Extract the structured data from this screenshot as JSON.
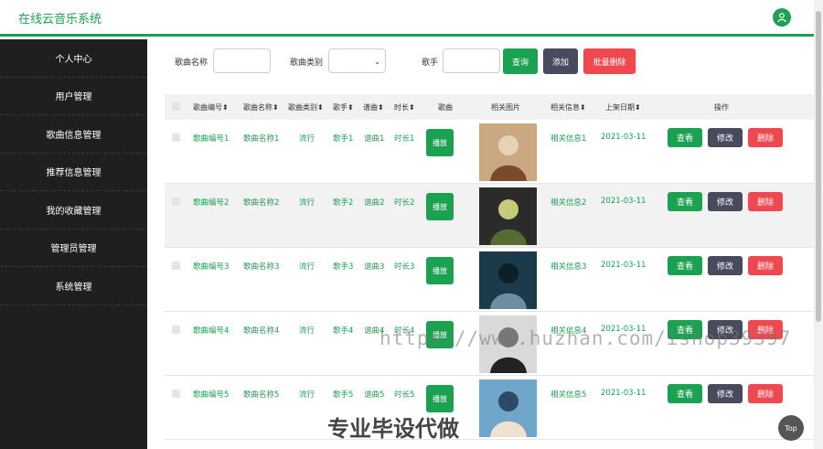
{
  "app": {
    "title": "在线云音乐系统",
    "brand_color": "#1aa251"
  },
  "sidebar": {
    "items": [
      "个人中心",
      "用户管理",
      "歌曲信息管理",
      "推荐信息管理",
      "我的收藏管理",
      "管理员管理",
      "系统管理"
    ]
  },
  "search": {
    "song_name_label": "歌曲名称",
    "song_name_value": "",
    "song_type_label": "歌曲类别",
    "singer_label": "歌手",
    "singer_value": "",
    "query_button": "查询",
    "add_button": "添加",
    "batch_delete_button": "批量删除"
  },
  "table": {
    "headers": [
      "歌曲编号",
      "歌曲名称",
      "歌曲类别",
      "歌手",
      "谱曲",
      "时长",
      "歌曲",
      "相关图片",
      "相关信息",
      "上架日期",
      "操作"
    ],
    "rows": [
      {
        "id": "歌曲编号1",
        "name": "歌曲名称1",
        "type": "流行",
        "singer": "歌手1",
        "composer": "谱曲1",
        "duration": "时长1",
        "play": "播放",
        "info": "相关信息1",
        "date": "2021-03-11"
      },
      {
        "id": "歌曲编号2",
        "name": "歌曲名称2",
        "type": "流行",
        "singer": "歌手2",
        "composer": "谱曲2",
        "duration": "时长2",
        "play": "播放",
        "info": "相关信息2",
        "date": "2021-03-11"
      },
      {
        "id": "歌曲编号3",
        "name": "歌曲名称3",
        "type": "流行",
        "singer": "歌手3",
        "composer": "谱曲3",
        "duration": "时长3",
        "play": "播放",
        "info": "相关信息3",
        "date": "2021-03-11"
      },
      {
        "id": "歌曲编号4",
        "name": "歌曲名称4",
        "type": "流行",
        "singer": "歌手4",
        "composer": "谱曲4",
        "duration": "时长4",
        "play": "播放",
        "info": "相关信息4",
        "date": "2021-03-11"
      },
      {
        "id": "歌曲编号5",
        "name": "歌曲名称5",
        "type": "流行",
        "singer": "歌手5",
        "composer": "谱曲5",
        "duration": "时长5",
        "play": "播放",
        "info": "相关信息5",
        "date": "2021-03-11"
      }
    ],
    "actions": {
      "view": "查看",
      "edit": "修改",
      "delete": "删除"
    }
  },
  "watermark": "https://www.huzhan.com/ishop39397",
  "slogan": "专业毕设代做",
  "top_button": "Top",
  "colors": {
    "green": "#1aa251",
    "dark": "#474b5b",
    "red": "#f0484f"
  }
}
